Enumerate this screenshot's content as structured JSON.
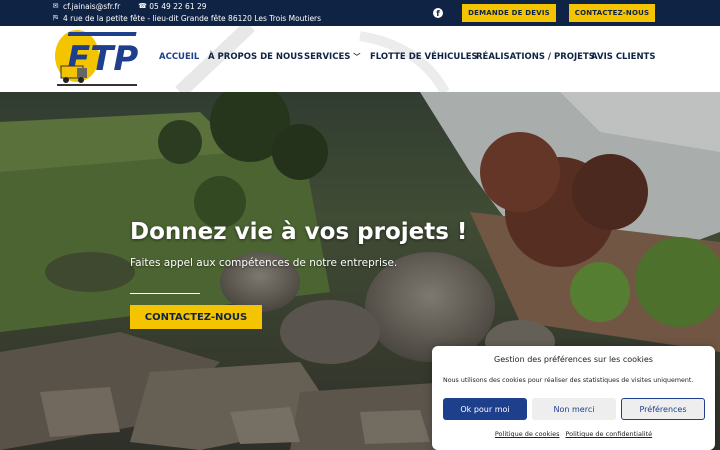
{
  "topbar": {
    "email": "cf.jainais@sfr.fr",
    "phone": "05 49 22 61 29",
    "address": "4 rue de la petite fête - lieu-dit Grande fête 86120 Les Trois Moutiers",
    "social_icon": "facebook-icon",
    "devis_label": "DEMANDE DE DEVIS",
    "contact_label": "CONTACTEZ-NOUS"
  },
  "logo": {
    "text": "FTP"
  },
  "nav": {
    "items": [
      "ACCUEIL",
      "À PROPOS DE NOUS",
      "SERVICES",
      "FLOTTE DE VÉHICULES",
      "RÉALISATIONS / PROJETS",
      "AVIS CLIENTS"
    ],
    "active": "ACCUEIL"
  },
  "hero": {
    "title": "Donnez vie à vos projets !",
    "subtitle": "Faites appel aux compétences de notre entreprise.",
    "cta": "CONTACTEZ-NOUS"
  },
  "cookie": {
    "title": "Gestion des préférences sur les cookies",
    "text": "Nous utilisons des cookies pour réaliser des statistiques de visites uniquement.",
    "accept": "Ok pour moi",
    "refuse": "Non merci",
    "preferences": "Préférences",
    "link_cookies": "Politique de cookies",
    "link_privacy": "Politique de confidentialité"
  },
  "colors": {
    "navy": "#0f2344",
    "accent": "#f5c400",
    "button_blue": "#1e3f8c"
  }
}
